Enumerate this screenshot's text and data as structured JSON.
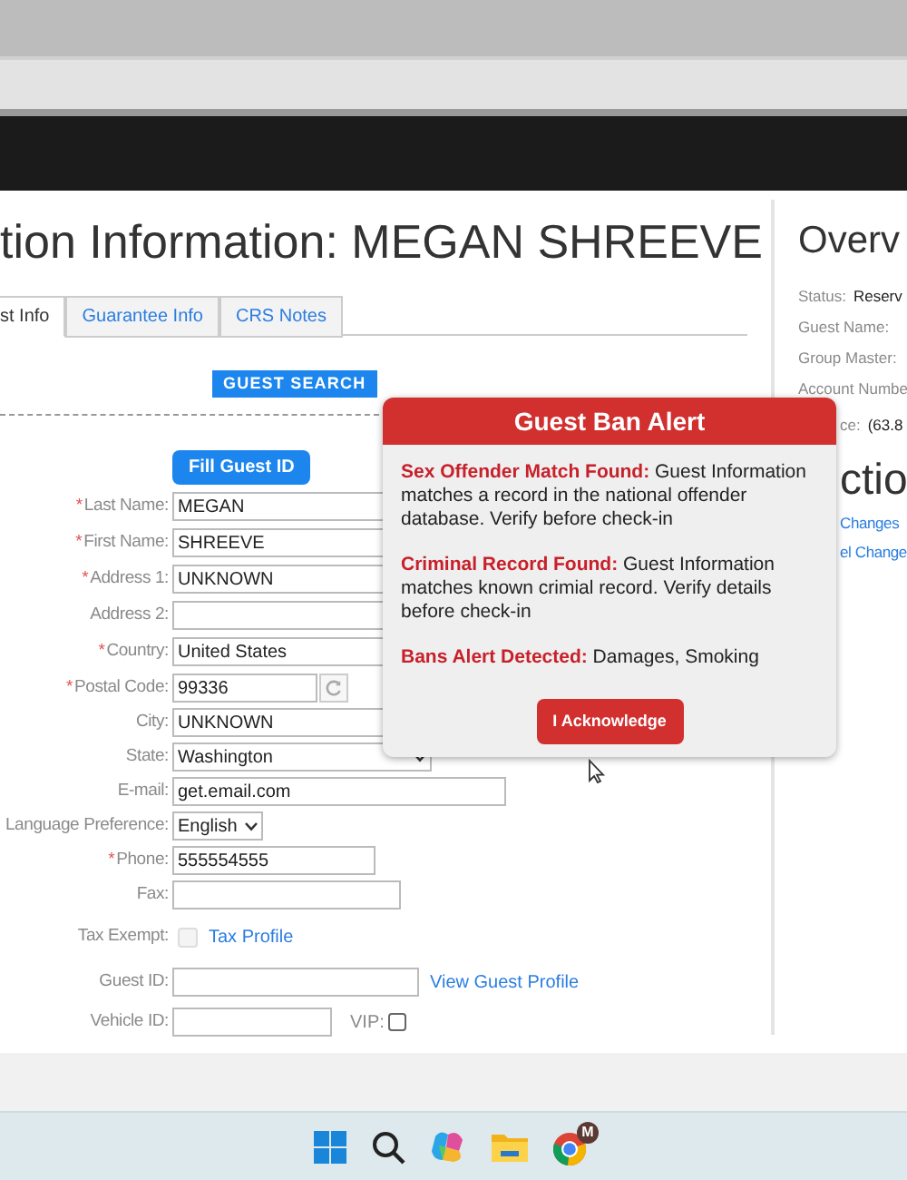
{
  "page_title": "tion Information: MEGAN SHREEVE",
  "tabs": [
    {
      "label": "st Info",
      "selected": true
    },
    {
      "label": "Guarantee Info",
      "selected": false
    },
    {
      "label": "CRS Notes",
      "selected": false
    }
  ],
  "guest_search_button": "GUEST SEARCH",
  "fill_guest_id_button": "Fill Guest ID",
  "fields": [
    {
      "kind": "input",
      "label": "Last Name:",
      "required_mark": "*",
      "value": "MEGAN"
    },
    {
      "kind": "input",
      "label": "First Name:",
      "required_mark": "*",
      "value": "SHREEVE"
    },
    {
      "kind": "input",
      "label": "Address 1:",
      "required_mark": "*",
      "value": "UNKNOWN"
    },
    {
      "kind": "input",
      "label": "Address 2:"
    },
    {
      "kind": "input",
      "label": "Country:",
      "required_mark": "*",
      "value": "United States"
    },
    {
      "kind": "postal",
      "label": "Postal Code:",
      "required_mark": "*",
      "value": "99336"
    },
    {
      "kind": "input",
      "label": "City:",
      "value": "UNKNOWN"
    },
    {
      "kind": "select",
      "label": "State:",
      "value": "Washington"
    },
    {
      "kind": "input",
      "label": "E-mail:",
      "value": "get.email.com"
    },
    {
      "kind": "select",
      "label": "Language Preference:",
      "value": "English"
    },
    {
      "kind": "input",
      "label": "Phone:",
      "required_mark": "*",
      "value": "555554555"
    },
    {
      "kind": "input",
      "label": "Fax:"
    },
    {
      "kind": "checkbox",
      "label": "Tax Exempt:",
      "checked": false,
      "disabled": true,
      "link": "Tax Profile"
    },
    {
      "kind": "input",
      "label": "Guest ID:",
      "link": "View Guest Profile"
    },
    {
      "kind": "input",
      "label": "Vehicle ID:",
      "extra_label": "VIP:",
      "extra_checked": false
    }
  ],
  "overview": {
    "title": "Overv",
    "rows": [
      {
        "label": "Status:",
        "value": "Reserv"
      },
      {
        "label": "Guest Name:"
      },
      {
        "label": "Group Master:"
      },
      {
        "label": "Account Numbe"
      },
      {
        "label": "ce:",
        "value": "(63.8"
      }
    ]
  },
  "actions": {
    "title": "ctio",
    "links": [
      "Changes",
      "el Change"
    ]
  },
  "alert": {
    "title": "Guest Ban Alert",
    "messages": [
      {
        "label": "Sex Offender Match Found:",
        "text": "Guest Information matches a record in the national offender database. Verify before check-in"
      },
      {
        "label": "Criminal Record Found:",
        "text": "Guest Information matches known crimial record. Verify details before check-in"
      },
      {
        "label": "Bans Alert Detected:",
        "text": "Damages, Smoking"
      }
    ],
    "button": "I Acknowledge"
  },
  "taskbar": {
    "badge": "M"
  }
}
